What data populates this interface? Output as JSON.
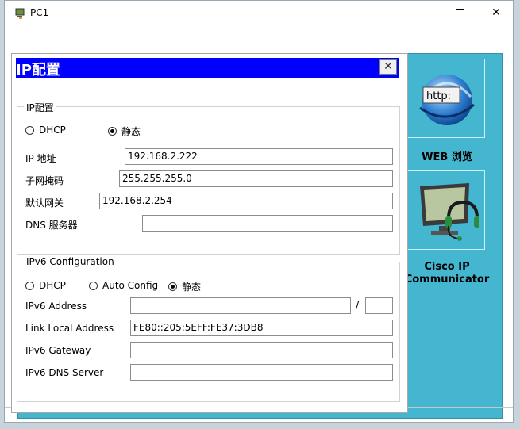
{
  "window": {
    "title": "PC1",
    "minimize_glyph": "—",
    "close_glyph": "✕"
  },
  "desktop": {
    "web_label": "WEB 浏览",
    "web_icon_text": "http:",
    "cisco_label_line1": "Cisco IP",
    "cisco_label_line2": "Communicator"
  },
  "dialog": {
    "title": "IP配置",
    "close_glyph": "✕",
    "ipv4": {
      "legend": "IP配置",
      "dhcp_label": "DHCP",
      "static_label": "静态",
      "ip_label": "IP 地址",
      "ip_value": "192.168.2.222",
      "mask_label": "子网掩码",
      "mask_value": "255.255.255.0",
      "gateway_label": "默认网关",
      "gateway_value": "192.168.2.254",
      "dns_label": "DNS 服务器",
      "dns_value": ""
    },
    "ipv6": {
      "legend": "IPv6 Configuration",
      "dhcp_label": "DHCP",
      "auto_label": "Auto Config",
      "static_label": "静态",
      "address_label": "IPv6 Address",
      "address_value": "",
      "prefix_separator": "/",
      "prefix_value": "",
      "link_local_label": "Link Local Address",
      "link_local_value": "FE80::205:5EFF:FE37:3DB8",
      "gateway_label": "IPv6 Gateway",
      "gateway_value": "",
      "dns_label": "IPv6 DNS Server",
      "dns_value": ""
    }
  },
  "colors": {
    "dialog_header": "#0000ff",
    "desktop_bg": "#44b6cf"
  }
}
